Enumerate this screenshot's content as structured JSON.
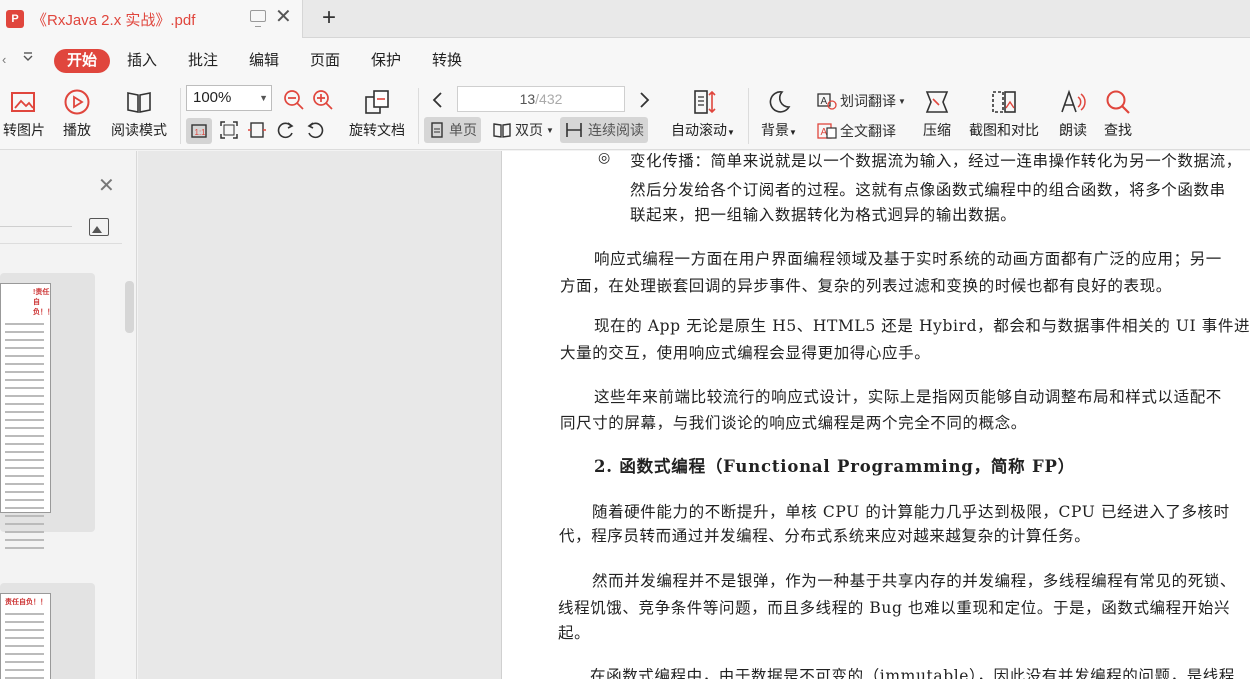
{
  "tab": {
    "icon_letter": "P",
    "title": "《RxJava 2.x 实战》.pdf",
    "close": "✕",
    "new_tab": "+"
  },
  "menu": {
    "dropdown_left": "‹",
    "dropdown_toggle": "⩢",
    "items": [
      "开始",
      "插入",
      "批注",
      "编辑",
      "页面",
      "保护",
      "转换"
    ],
    "active_index": 0
  },
  "toolbar": {
    "to_image": "转图片",
    "play": "播放",
    "read_mode": "阅读模式",
    "zoom_value": "100%",
    "rotate_doc": "旋转文档",
    "page_current": "13",
    "page_total": "/432",
    "single_page": "单页",
    "double_page": "双页",
    "continuous": "连续阅读",
    "auto_scroll": "自动滚动",
    "background": "背景",
    "word_translate": "划词翻译",
    "full_translate": "全文翻译",
    "compress": "压缩",
    "screenshot_compare": "截图和对比",
    "read_aloud": "朗读",
    "find": "查找"
  },
  "sidepanel": {
    "close": "✕",
    "thumb1_header": "!责任自负！！",
    "thumb2_header": "责任自负！！"
  },
  "document": {
    "bullet_symbol": "◎",
    "bullet_lines": [
      "变化传播：简单来说就是以一个数据流为输入，经过一连串操作转化为另一个数据流，",
      "然后分发给各个订阅者的过程。这就有点像函数式编程中的组合函数，将多个函数串",
      "联起来，把一组输入数据转化为格式迥异的输出数据。"
    ],
    "p1": [
      "响应式编程一方面在用户界面编程领域及基于实时系统的动画方面都有广泛的应用；另一",
      "方面，在处理嵌套回调的异步事件、复杂的列表过滤和变换的时候也都有良好的表现。"
    ],
    "p2": [
      "现在的 App 无论是原生 H5、HTML5 还是 Hybird，都会和与数据事件相关的 UI 事件进行",
      "大量的交互，使用响应式编程会显得更加得心应手。"
    ],
    "p3": [
      "这些年来前端比较流行的响应式设计，实际上是指网页能够自动调整布局和样式以适配不",
      "同尺寸的屏幕，与我们谈论的响应式编程是两个完全不同的概念。"
    ],
    "heading": "2.  函数式编程（Functional Programming，简称 FP）",
    "p4": [
      "随着硬件能力的不断提升，单核 CPU 的计算能力几乎达到极限，CPU 已经进入了多核时",
      "代，程序员转而通过并发编程、分布式系统来应对越来越复杂的计算任务。"
    ],
    "p5": [
      "然而并发编程并不是银弹，作为一种基于共享内存的并发编程，多线程编程有常见的死锁、",
      "线程饥饿、竞争条件等问题，而且多线程的 Bug 也难以重现和定位。于是，函数式编程开始兴",
      "起。"
    ],
    "p6": [
      "在函数式编程中，由于数据是不可变的（immutable），因此没有并发编程的问题，是线程"
    ]
  }
}
